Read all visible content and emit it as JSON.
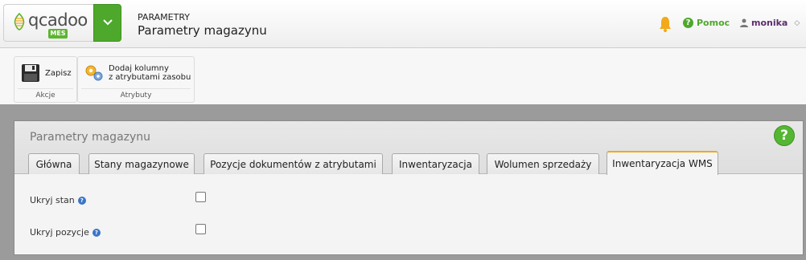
{
  "app": {
    "logo_text": "qcadoo",
    "logo_badge": "MES"
  },
  "breadcrumb": {
    "section": "PARAMETRY",
    "title": "Parametry magazynu"
  },
  "header": {
    "help_label": "Pomoc",
    "help_glyph": "?",
    "user_name": "monika",
    "user_caret": "◇",
    "bell_icon": "bell-icon"
  },
  "toolbar": {
    "groups": [
      {
        "label": "Akcje",
        "buttons": [
          {
            "label": "Zapisz",
            "icon": "save-icon"
          }
        ]
      },
      {
        "label": "Atrybuty",
        "buttons": [
          {
            "label_line1": "Dodaj kolumny",
            "label_line2": "z atrybutami zasobu",
            "icon": "gears-icon"
          }
        ]
      }
    ]
  },
  "panel": {
    "title": "Parametry magazynu",
    "help_glyph": "?",
    "tabs": [
      {
        "label": "Główna",
        "active": false
      },
      {
        "label": "Stany magazynowe",
        "active": false
      },
      {
        "label": "Pozycje dokumentów z atrybutami",
        "active": false
      },
      {
        "label": "Inwentaryzacja",
        "active": false
      },
      {
        "label": "Wolumen sprzedaży",
        "active": false
      },
      {
        "label": "Inwentaryzacja WMS",
        "active": true
      }
    ],
    "fields": [
      {
        "label": "Ukryj stan",
        "checked": false,
        "hint_glyph": "?"
      },
      {
        "label": "Ukryj pozycje",
        "checked": false,
        "hint_glyph": "?"
      }
    ]
  },
  "colors": {
    "brand_green": "#4ea82b",
    "active_tab_accent": "#f2a91a",
    "user_purple": "#5b2d6e",
    "hint_blue": "#3a74c8"
  }
}
